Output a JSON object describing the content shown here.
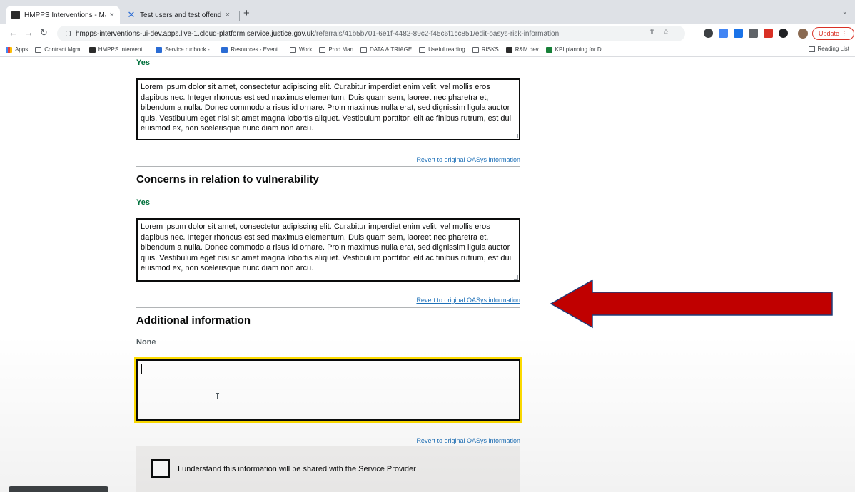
{
  "browser": {
    "tabs": [
      {
        "title": "HMPPS Interventions - Make a",
        "close": "×"
      },
      {
        "title": "Test users and test offenders",
        "close": "×"
      }
    ],
    "new_tab": "+",
    "url_host": "hmpps-interventions-ui-dev.apps.live-1.cloud-platform.service.justice.gov.uk",
    "url_path": "/referrals/41b5b701-6e1f-4482-89c2-f45c6f1cc851/edit-oasys-risk-information",
    "update_label": "Update",
    "bookmarks": [
      "Apps",
      "Contract Mgmt",
      "HMPPS Interventi...",
      "Service runbook -...",
      "Resources - Event...",
      "Work",
      "Prod Man",
      "DATA & TRIAGE",
      "Useful reading",
      "RISKS",
      "R&M dev",
      "KPI planning for D..."
    ],
    "reading_list": "Reading List"
  },
  "page": {
    "lorem": "Lorem ipsum dolor sit amet, consectetur adipiscing elit. Curabitur imperdiet enim velit, vel mollis eros dapibus nec. Integer rhoncus est sed maximus elementum. Duis quam sem, laoreet nec pharetra et, bibendum a nulla. Donec commodo a risus id ornare. Proin maximus nulla erat, sed dignissim ligula auctor quis. Vestibulum eget nisi sit amet magna lobortis aliquet. Vestibulum porttitor, elit ac finibus rutrum, est dui euismod ex, non scelerisque nunc diam non arcu.",
    "section1": {
      "answer": "Yes",
      "revert": "Revert to original OASys information"
    },
    "section2": {
      "heading": "Concerns in relation to vulnerability",
      "answer": "Yes",
      "revert": "Revert to original OASys information"
    },
    "section3": {
      "heading": "Additional information",
      "answer": "None",
      "textarea_value": "",
      "revert": "Revert to original OASys information"
    },
    "confirm": {
      "label": "I understand this information will be shared with the Service Provider"
    }
  },
  "colors": {
    "answer_green": "#00703c",
    "link_blue": "#1d70b8",
    "focus_yellow": "#ffdd00",
    "arrow_red": "#c00000",
    "arrow_border": "#1f3d7a"
  }
}
